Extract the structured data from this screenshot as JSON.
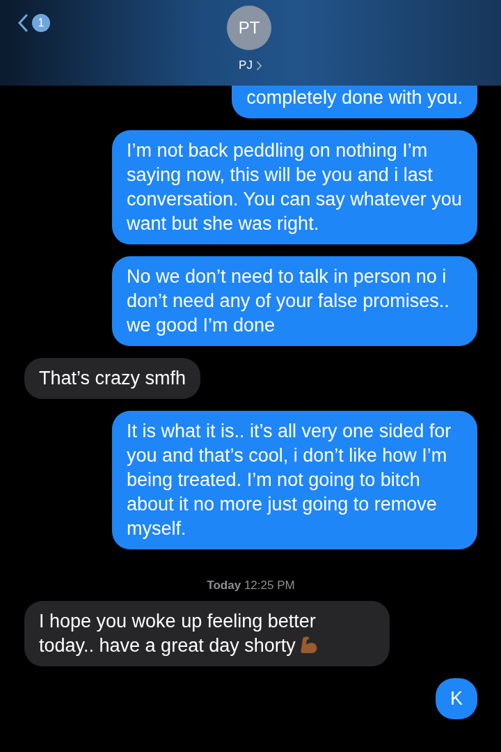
{
  "header": {
    "back_badge": "1",
    "avatar_initials": "PT",
    "contact_name": "PJ"
  },
  "messages": [
    {
      "kind": "sent",
      "text": "completely done with you.",
      "continued": true
    },
    {
      "kind": "sent",
      "text": "I’m not back peddling on nothing I’m saying now, this will be you and i last conversation. You can say whatever you want but she was right."
    },
    {
      "kind": "sent",
      "text": "No we don’t need to talk in person no i don’t need any of your false promises.. we good I’m done"
    },
    {
      "kind": "received",
      "text": "That’s crazy smfh"
    },
    {
      "kind": "sent",
      "text": "It is what it is.. it’s all very one sided for you and that’s cool, i don’t like how I’m being treated. I’m not going to bitch about it no more just going to remove myself."
    },
    {
      "kind": "timestamp",
      "day": "Today",
      "time": "12:25 PM"
    },
    {
      "kind": "received",
      "text": "I hope you woke up feeling better today.. have a great day shorty",
      "has_icon": true
    },
    {
      "kind": "sent",
      "text": "K"
    }
  ]
}
